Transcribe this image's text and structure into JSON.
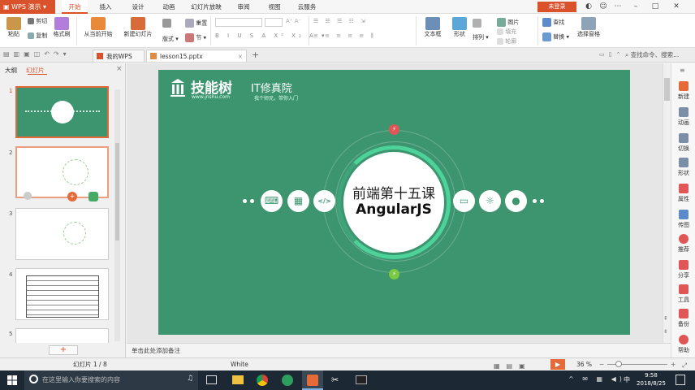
{
  "app": {
    "title": "WPS 演示",
    "login_label": "未登录",
    "ribbon_tabs": [
      {
        "label": "开始",
        "active": true
      },
      {
        "label": "插入",
        "active": false
      },
      {
        "label": "设计",
        "active": false
      },
      {
        "label": "动画",
        "active": false
      },
      {
        "label": "幻灯片放映",
        "active": false
      },
      {
        "label": "审阅",
        "active": false
      },
      {
        "label": "视图",
        "active": false
      },
      {
        "label": "云服务",
        "active": false
      }
    ]
  },
  "ribbon": {
    "paste": "粘贴",
    "cut": "剪切",
    "copy": "复制",
    "format_painter": "格式刷",
    "play_from_current": "从当前开始",
    "new_slide": "新建幻灯片",
    "layout": "版式",
    "section": "节",
    "reset": "重置",
    "text_box": "文本框",
    "shape": "形状",
    "arrange": "排列",
    "picture": "图片",
    "fill": "填充",
    "outline": "轮廓",
    "find": "查找",
    "replace": "替换",
    "select_pane": "选择窗格",
    "search_placeholder": "查找命令、搜索..."
  },
  "doc_tabs": [
    {
      "label": "我的WPS",
      "active": false
    },
    {
      "label": "lesson15.pptx",
      "active": true
    }
  ],
  "left_panel": {
    "tab_outline": "大纲",
    "tab_slides": "幻灯片",
    "slide_numbers": [
      "1",
      "2",
      "3",
      "4",
      "5"
    ],
    "add_label": "+"
  },
  "slide": {
    "brand_name": "技能树",
    "brand_url": "www.jnshu.com",
    "brand_suffix": "IT修真院",
    "brand_tagline": "我个师兄，带你入门",
    "title_cn": "前端第十五课",
    "title_en": "AngularJS"
  },
  "right_panel": {
    "items": [
      {
        "label": "新建",
        "icon": "new-icon"
      },
      {
        "label": "动画",
        "icon": "animation-icon"
      },
      {
        "label": "切换",
        "icon": "transition-icon"
      },
      {
        "label": "形状",
        "icon": "shape-icon"
      },
      {
        "label": "属性",
        "icon": "property-icon"
      },
      {
        "label": "传图",
        "icon": "upload-image-icon"
      },
      {
        "label": "推荐",
        "icon": "recommend-icon"
      },
      {
        "label": "分享",
        "icon": "share-icon"
      },
      {
        "label": "工具",
        "icon": "tools-icon"
      },
      {
        "label": "备份",
        "icon": "backup-icon"
      },
      {
        "label": "帮助",
        "icon": "help-icon"
      }
    ]
  },
  "notes_placeholder": "单击此处添加备注",
  "status": {
    "slide_info": "幻灯片 1 / 8",
    "theme": "White",
    "zoom": "36 %"
  },
  "taskbar": {
    "search_placeholder": "在这里输入你要搜索的内容",
    "time": "9:58",
    "date": "2018/8/25",
    "ime": "中"
  },
  "colors": {
    "accent": "#d9522c",
    "slide_bg": "#3d9570",
    "ring": "#4dd39a"
  }
}
